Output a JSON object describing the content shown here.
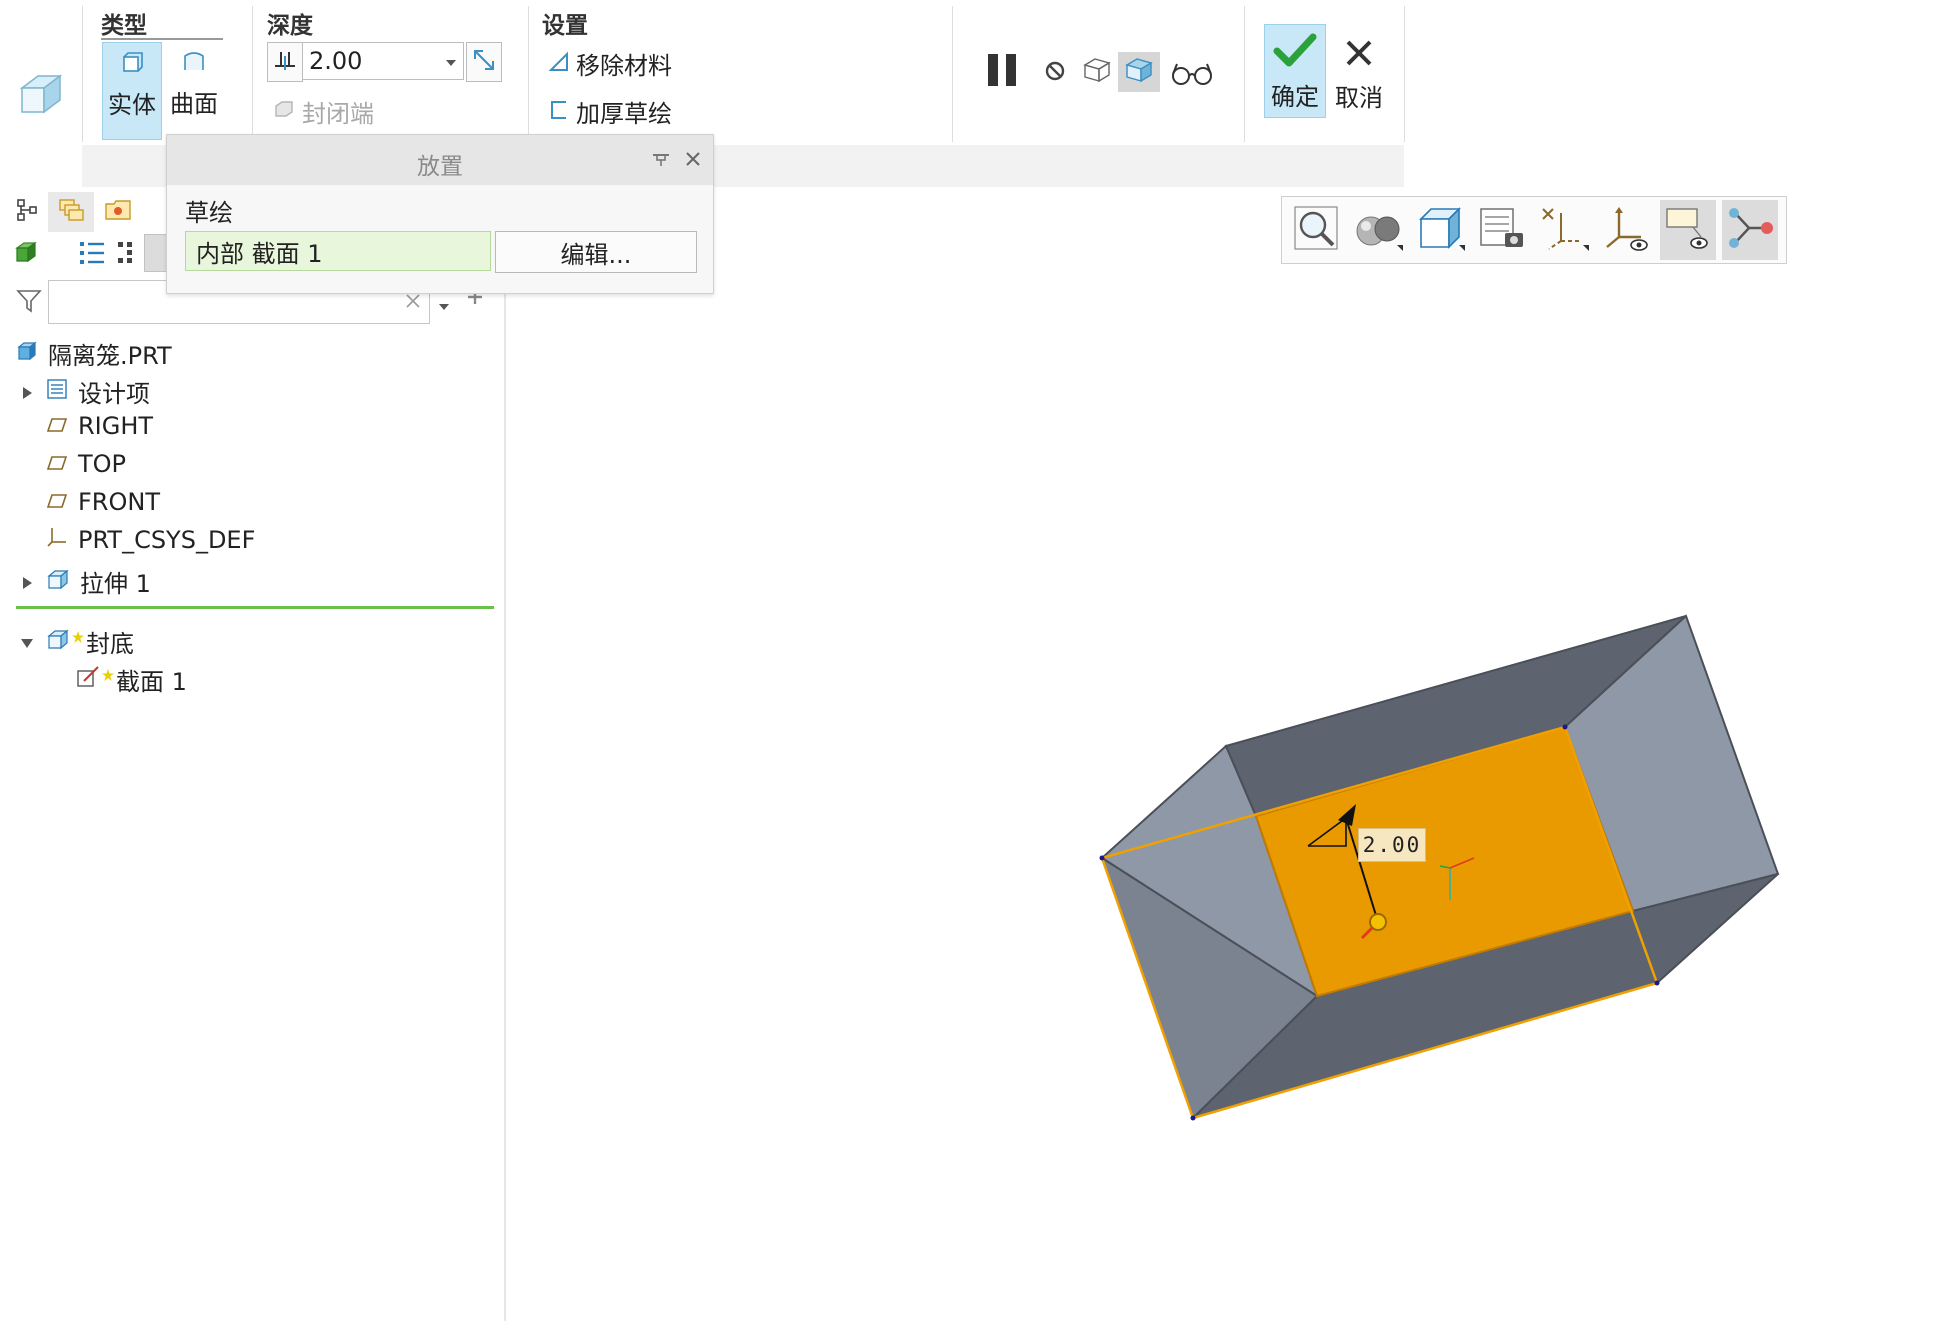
{
  "ribbon": {
    "type_group": {
      "title": "类型",
      "solid_label": "实体",
      "surface_label": "曲面"
    },
    "depth_group": {
      "title": "深度",
      "value": "2.00",
      "capped_label": "封闭端"
    },
    "settings_group": {
      "title": "设置",
      "remove_material_label": "移除材料",
      "thicken_label": "加厚草绘"
    },
    "confirm_label": "确定",
    "cancel_label": "取消"
  },
  "placement_panel": {
    "title": "放置",
    "sketch_label": "草绘",
    "sketch_value": "内部 截面 1",
    "edit_button": "编辑..."
  },
  "model_tree": {
    "items": [
      {
        "label": "隔离笼.PRT"
      },
      {
        "label": "设计项"
      },
      {
        "label": "RIGHT"
      },
      {
        "label": "TOP"
      },
      {
        "label": "FRONT"
      },
      {
        "label": "PRT_CSYS_DEF"
      },
      {
        "label": "拉伸 1"
      },
      {
        "label": "封底"
      },
      {
        "label": "截面 1"
      }
    ]
  },
  "viewport": {
    "dimension_value": "2.00",
    "colors": {
      "sketch_fill": "#e99a00",
      "outline": "#f0a000",
      "box_dark": "#5d6470",
      "box_light": "#8f98a6"
    }
  }
}
